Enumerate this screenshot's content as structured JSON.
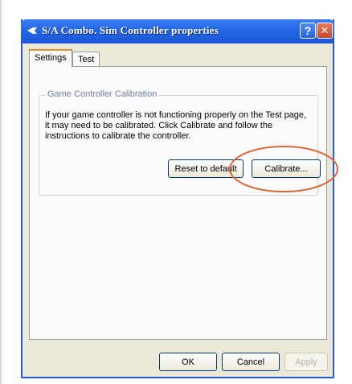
{
  "window": {
    "title": "S/A Combo. Sim Controller properties",
    "help_label": "?",
    "close_label": "✕"
  },
  "tabs": [
    {
      "label": "Settings",
      "active": true
    },
    {
      "label": "Test",
      "active": false
    }
  ],
  "calibration": {
    "group_title": "Game Controller Calibration",
    "description": "If your game controller is not functioning properly on the Test page, it may need to be calibrated.  Click Calibrate and follow the instructions to calibrate the controller.",
    "reset_label": "Reset to default",
    "calibrate_label": "Calibrate..."
  },
  "footer": {
    "ok_label": "OK",
    "cancel_label": "Cancel",
    "apply_label": "Apply"
  },
  "colors": {
    "titlebar": "#2466e6",
    "highlight_ring": "#e0643a",
    "dialog_bg": "#ece9d8"
  }
}
